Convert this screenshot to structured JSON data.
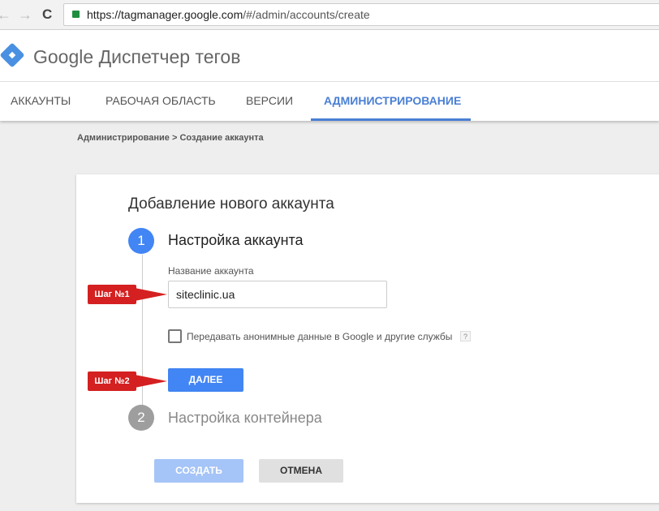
{
  "browser": {
    "url_host": "https://tagmanager.google.com",
    "url_path": "/#/admin/accounts/create",
    "back": "←",
    "forward": "→",
    "reload": "C"
  },
  "header": {
    "brand": "Google",
    "product": "Диспетчер тегов"
  },
  "tabs": [
    {
      "label": "АККАУНТЫ"
    },
    {
      "label": "РАБОЧАЯ ОБЛАСТЬ"
    },
    {
      "label": "ВЕРСИИ"
    },
    {
      "label": "АДМИНИСТРИРОВАНИЕ"
    }
  ],
  "breadcrumb": "Администрирование > Создание аккаунта",
  "form": {
    "title": "Добавление нового аккаунта",
    "step1": {
      "num": "1",
      "title": "Настройка аккаунта"
    },
    "account_label": "Название аккаунта",
    "account_value": "siteclinic.ua",
    "share_label": "Передавать анонимные данные в Google и другие службы",
    "help": "?",
    "next": "ДАЛЕЕ",
    "step2": {
      "num": "2",
      "title": "Настройка контейнера"
    },
    "create": "СОЗДАТЬ",
    "cancel": "ОТМЕНА"
  },
  "callouts": [
    "Шаг №1",
    "Шаг №2"
  ],
  "colors": {
    "accent": "#4285f4",
    "callout": "#d42020"
  }
}
